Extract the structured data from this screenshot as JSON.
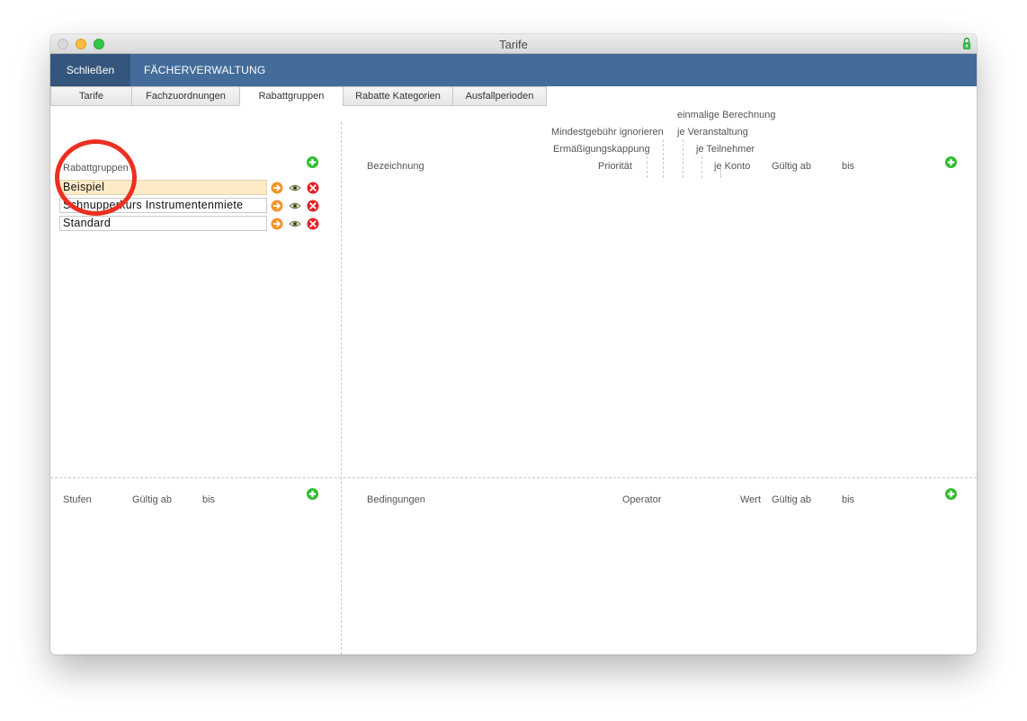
{
  "window": {
    "title": "Tarife"
  },
  "menubar": {
    "close_label": "Schließen",
    "faecher_label": "FÄCHERVERWALTUNG"
  },
  "tabs": [
    {
      "label": "Tarife",
      "active": false
    },
    {
      "label": "Fachzuordnungen",
      "active": false
    },
    {
      "label": "Rabattgruppen",
      "active": true
    },
    {
      "label": "Rabatte Kategorien",
      "active": false
    },
    {
      "label": "Ausfallperioden",
      "active": false
    }
  ],
  "rabattgruppen": {
    "header": "Rabattgruppen",
    "items": [
      {
        "name": "Beispiel",
        "selected": true
      },
      {
        "name": "Schnupperkurs Instrumentenmiete",
        "selected": false
      },
      {
        "name": "Standard",
        "selected": false
      }
    ]
  },
  "rabatte_columns": {
    "bezeichnung": "Bezeichnung",
    "prioritaet": "Priorität",
    "ermaessigungskappung": "Ermäßigungskappung",
    "mindestgebuehr": "Mindestgebühr ignorieren",
    "einmalige_berechnung": "einmalige Berechnung",
    "je_veranstaltung": "je Veranstaltung",
    "je_teilnehmer": "je Teilnehmer",
    "je_konto": "je Konto",
    "gueltig_ab": "Gültig ab",
    "bis": "bis"
  },
  "stufen_columns": {
    "stufen": "Stufen",
    "gueltig_ab": "Gültig ab",
    "bis": "bis"
  },
  "bedingungen_columns": {
    "bedingungen": "Bedingungen",
    "operator": "Operator",
    "wert": "Wert",
    "gueltig_ab": "Gültig ab",
    "bis": "bis"
  },
  "colors": {
    "menubar": "#446c9a",
    "close_button": "#35567c",
    "selected_row": "#fdebc8",
    "add_icon": "#2dbd2d",
    "delete_icon": "#e0242a",
    "goto_icon": "#f0952b",
    "annotation": "#ec2f20"
  },
  "icons": {
    "add": "plus-circle-icon",
    "goto": "arrow-right-circle-icon",
    "view": "eye-icon",
    "delete": "x-circle-icon",
    "lock": "lock-icon"
  }
}
